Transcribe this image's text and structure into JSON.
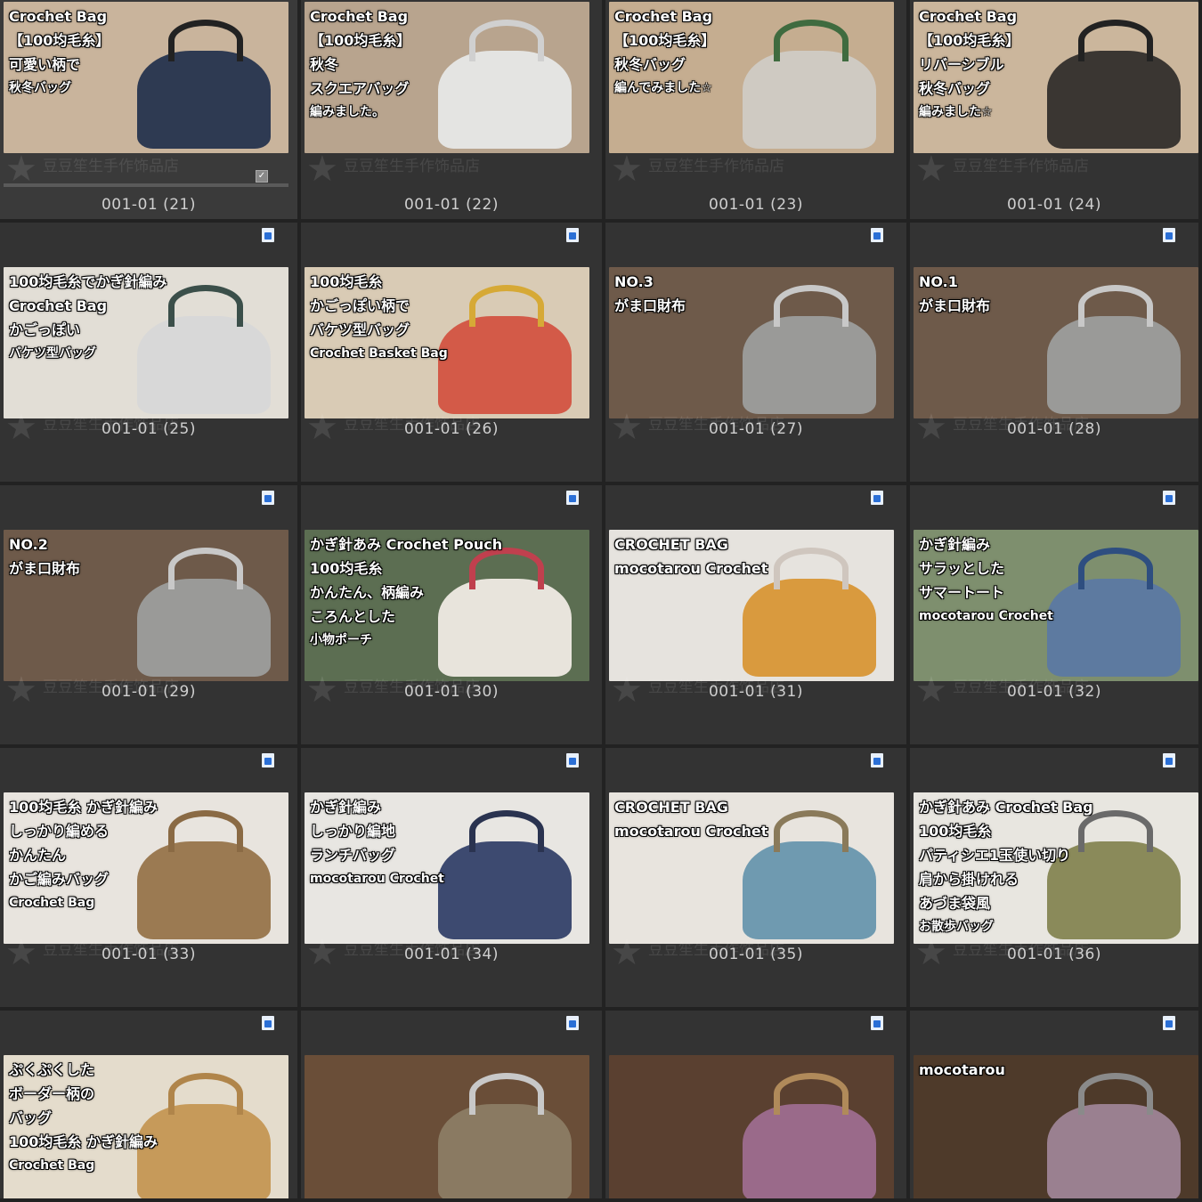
{
  "watermark": "豆豆笙生手作饰品店",
  "tiles": [
    {
      "caption": "001-01 (21)",
      "bg": "#c9b49c",
      "lines": [
        "Crochet Bag",
        "【100均毛糸】",
        "可愛い柄で",
        "秋冬バッグ"
      ],
      "obj": "#2e3a52",
      "handle": "#222"
    },
    {
      "caption": "001-01 (22)",
      "bg": "#b8a48e",
      "lines": [
        "Crochet Bag",
        "【100均毛糸】",
        "秋冬",
        "スクエアバッグ",
        "編みました。"
      ],
      "obj": "#e4e4e2",
      "handle": "#d0d0d0"
    },
    {
      "caption": "001-01 (23)",
      "bg": "#c5ad90",
      "lines": [
        "Crochet Bag",
        "【100均毛糸】",
        "秋冬バッグ",
        "編んでみました☆"
      ],
      "obj": "#cfcac2",
      "handle": "#3f6b3f"
    },
    {
      "caption": "001-01 (24)",
      "bg": "#cbb69c",
      "lines": [
        "Crochet Bag",
        "【100均毛糸】",
        "リバーシブル",
        "秋冬バッグ",
        "編みました☆"
      ],
      "obj": "#3a3632",
      "handle": "#222"
    },
    {
      "caption": "001-01 (25)",
      "bg": "#e2ded6",
      "lines": [
        "100均毛糸でかぎ針編み",
        "Crochet Bag",
        "かごっぽい",
        "バケツ型バッグ"
      ],
      "obj": "#d8d8d8",
      "handle": "#3b4f4a"
    },
    {
      "caption": "001-01 (26)",
      "bg": "#d9cbb5",
      "lines": [
        "100均毛糸",
        "かごっぽい柄で",
        "バケツ型バッグ",
        "Crochet Basket Bag"
      ],
      "obj": "#d35a48",
      "handle": "#d6a936"
    },
    {
      "caption": "001-01 (27)",
      "bg": "#6e5a4a",
      "lines": [
        "NO.3",
        "がま口財布"
      ],
      "obj": "#9a9a98",
      "handle": "#c8c8c8"
    },
    {
      "caption": "001-01 (28)",
      "bg": "#6e5a4a",
      "lines": [
        "NO.1",
        "がま口財布"
      ],
      "obj": "#9a9a98",
      "handle": "#c8c8c8"
    },
    {
      "caption": "001-01 (29)",
      "bg": "#6e5a4a",
      "lines": [
        "NO.2",
        "がま口財布"
      ],
      "obj": "#9a9a98",
      "handle": "#c8c8c8"
    },
    {
      "caption": "001-01 (30)",
      "bg": "#5c6e52",
      "lines": [
        "かぎ針あみ Crochet Pouch",
        "100均毛糸",
        "かんたん、柄編み",
        "ころんとした",
        "小物ポーチ"
      ],
      "obj": "#e8e4dc",
      "handle": "#c0404e"
    },
    {
      "caption": "001-01 (31)",
      "bg": "#e6e3de",
      "lines": [
        "CROCHET BAG",
        "mocotarou Crochet"
      ],
      "obj": "#d99a3e",
      "handle": "#cfc6be"
    },
    {
      "caption": "001-01 (32)",
      "bg": "#7e8f6e",
      "lines": [
        "かぎ針編み",
        "サラッとした",
        "サマートート",
        "mocotarou Crochet"
      ],
      "obj": "#5d7aa0",
      "handle": "#2e4e80"
    },
    {
      "caption": "001-01 (33)",
      "bg": "#e8e4de",
      "lines": [
        "100均毛糸 かぎ針編み",
        "しっかり編める",
        "かんたん",
        "かご編みバッグ",
        "Crochet Bag"
      ],
      "obj": "#9b7a52",
      "handle": "#8a6a44"
    },
    {
      "caption": "001-01 (34)",
      "bg": "#e8e6e2",
      "lines": [
        "かぎ針編み",
        "しっかり編地",
        "ランチバッグ",
        "mocotarou Crochet"
      ],
      "obj": "#3d4a70",
      "handle": "#2a3350"
    },
    {
      "caption": "001-01 (35)",
      "bg": "#e8e4de",
      "lines": [
        "CROCHET BAG",
        "mocotarou Crochet"
      ],
      "obj": "#6f9ab0",
      "handle": "#8a7a5a"
    },
    {
      "caption": "001-01 (36)",
      "bg": "#e8e6e0",
      "lines": [
        "かぎ針あみ Crochet Bag",
        "100均毛糸",
        "パティシエ1玉使い切り",
        "肩から掛けれる",
        "あづま袋風",
        "お散歩バッグ"
      ],
      "obj": "#8a8a5a",
      "handle": "#6a6a6a"
    },
    {
      "caption": "",
      "bg": "#e4dccc",
      "lines": [
        "ぷくぷくした",
        "ボーダー柄の",
        "バッグ",
        "100均毛糸 かぎ針編み",
        "Crochet Bag"
      ],
      "obj": "#c69a5a",
      "handle": "#b0854a"
    },
    {
      "caption": "",
      "bg": "#6a4e38",
      "lines": [],
      "obj": "#8a7a62",
      "handle": "#c8c8c8"
    },
    {
      "caption": "",
      "bg": "#5a4030",
      "lines": [],
      "obj": "#9a6a8a",
      "handle": "#b08a5a"
    },
    {
      "caption": "",
      "bg": "#4e3a2a",
      "lines": [
        "mocotarou"
      ],
      "obj": "#9a8090",
      "handle": "#8a8a8a"
    }
  ]
}
